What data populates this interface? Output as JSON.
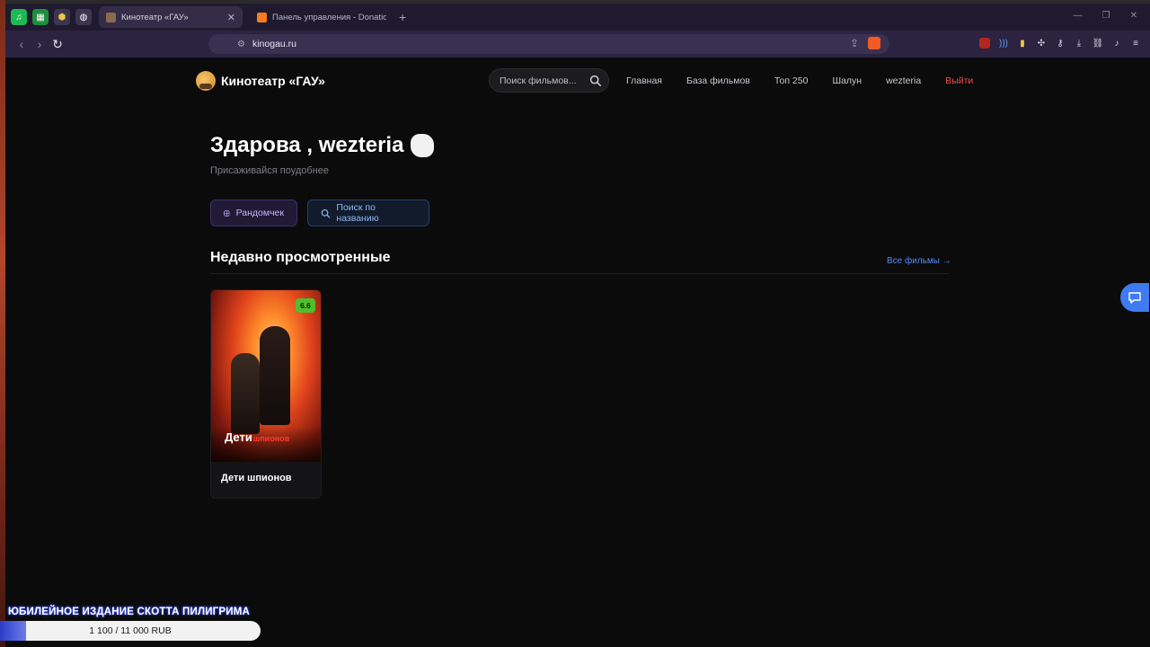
{
  "browser": {
    "tabs": [
      {
        "title": "Кинотеатр «ГАУ»",
        "active": true
      },
      {
        "title": "Панель управления - DonationAlerts",
        "active": false
      }
    ],
    "new_tab": "+",
    "url": "kinogau.ru",
    "pinned_icons": [
      "spotify-icon",
      "sheets-icon",
      "shield-icon",
      "globe-icon"
    ],
    "extension_icons": [
      "ublock-icon",
      "audio-icon",
      "wallet-icon",
      "puzzle-icon",
      "key-icon",
      "download-icon",
      "link-icon",
      "music-icon",
      "menu-icon"
    ]
  },
  "site": {
    "logo_text": "Кинотеатр «ГАУ»",
    "search_placeholder": "Поиск фильмов...",
    "nav": {
      "home": "Главная",
      "database": "База фильмов",
      "top": "Топ 250",
      "prank": "Шалун",
      "user": "wezteria",
      "logout": "Выйти"
    },
    "accent_color": "#4f8df7",
    "logout_color": "#ef4e4e"
  },
  "hero": {
    "title": "Здарова , wezteria",
    "subtitle": "Присаживайся поудобнее"
  },
  "actions": {
    "random": "Рандомчек",
    "search_by_name": "Поиск по названию"
  },
  "recent": {
    "title": "Недавно просмотренные",
    "all_link": "Все фильмы →",
    "movies": [
      {
        "title": "Дети шпионов",
        "rating": "6.6",
        "poster_text_1": "Дети",
        "poster_text_2": "шпионов",
        "rating_color": "#4fbf2b"
      }
    ]
  },
  "donation": {
    "goal_title": "ЮБИЛЕЙНОЕ ИЗДАНИЕ СКОТТА ПИЛИГРИМА",
    "progress_text": "1 100 / 11 000 RUB",
    "current": 1100,
    "target": 11000,
    "progress_fraction": 0.1
  }
}
